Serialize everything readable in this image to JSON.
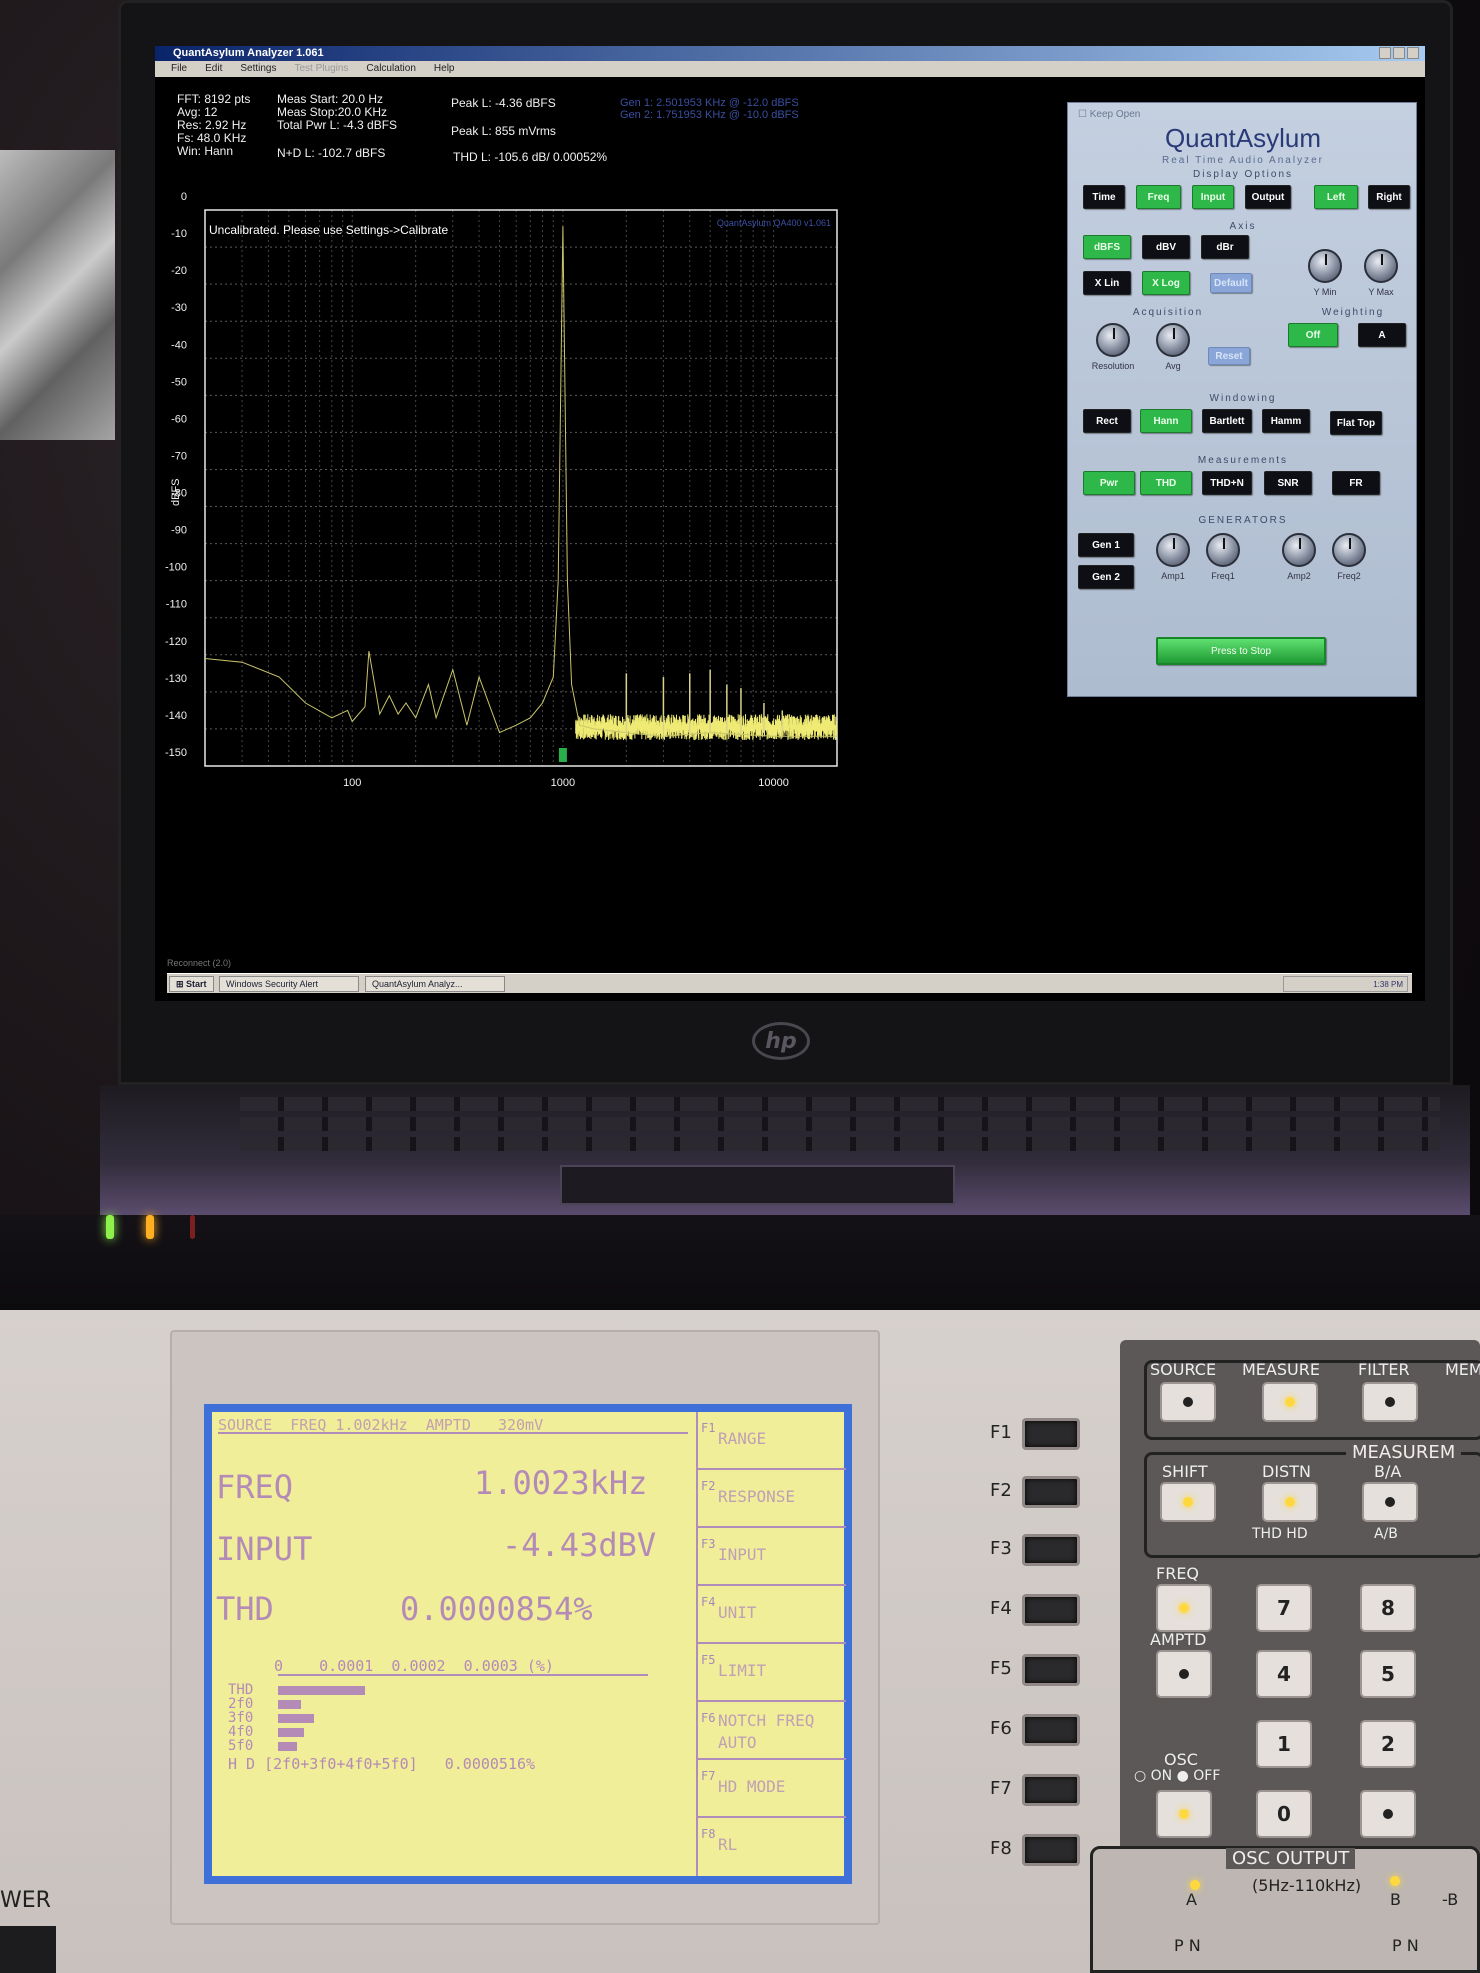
{
  "app": {
    "title": "QuantAsylum Analyzer 1.061",
    "menu": [
      "File",
      "Edit",
      "Settings",
      "Test Plugins",
      "Calculation",
      "Help"
    ]
  },
  "stats": {
    "fft": "FFT: 8192 pts",
    "avg": "Avg: 12",
    "res": "Res: 2.92 Hz",
    "fs": "Fs: 48.0 KHz",
    "win": "Win: Hann",
    "meas_start": "Meas Start: 20.0 Hz",
    "meas_stop": "Meas Stop:20.0 KHz",
    "total_pwr": "Total Pwr L: -4.3 dBFS",
    "nd": "N+D L: -102.7 dBFS",
    "peak_dbfs": "Peak L: -4.36 dBFS",
    "peak_mv": "Peak L: 855 mVrms",
    "thd": "THD L: -105.6 dB/ 0.00052%",
    "gen1": "Gen 1: 2.501953 KHz @ -12.0  dBFS",
    "gen2": "Gen 2: 1.751953 KHz @ -10.0  dBFS"
  },
  "chart_data": {
    "type": "line",
    "ylabel": "dBFS",
    "xscale": "log",
    "xlim": [
      20,
      20000
    ],
    "ylim": [
      -150,
      0
    ],
    "yticks": [
      "0",
      "-10",
      "-20",
      "-30",
      "-40",
      "-50",
      "-60",
      "-70",
      "-80",
      "-90",
      "-100",
      "-110",
      "-120",
      "-130",
      "-140",
      "-150"
    ],
    "xticks": [
      "100",
      "1000",
      "10000"
    ],
    "note": "Uncalibrated. Please use Settings->Calibrate",
    "watermark": "QuantAsylum QA400 v1.061",
    "grid": true,
    "x": [
      20,
      30,
      45,
      60,
      80,
      95,
      100,
      115,
      120,
      135,
      150,
      165,
      180,
      200,
      230,
      250,
      300,
      350,
      400,
      500,
      600,
      700,
      800,
      900,
      950,
      1000,
      1050,
      1100,
      1200,
      1400,
      2000,
      3000,
      5000,
      10000,
      20000
    ],
    "y": [
      -121,
      -122,
      -126,
      -133,
      -137,
      -135,
      -138,
      -134,
      -119,
      -136,
      -131,
      -136,
      -133,
      -137,
      -128,
      -137,
      -124,
      -139,
      -126,
      -141,
      -139,
      -137,
      -133,
      -126,
      -100,
      -4.4,
      -100,
      -128,
      -139,
      -140,
      -141,
      -142,
      -141,
      -142,
      -142
    ],
    "harmonics_x": [
      2000,
      3000,
      4000,
      5000,
      6000,
      7000,
      9000,
      11000
    ],
    "harmonics_y": [
      -125,
      -126,
      -125,
      -124,
      -128,
      -129,
      -133,
      -135
    ]
  },
  "panel": {
    "keep_open": "Keep Open",
    "brand": "QuantAsylum",
    "subtitle": "Real Time Audio Analyzer",
    "sections": {
      "display": "Display Options",
      "axis": "Axis",
      "acquisition": "Acquisition",
      "weighting": "Weighting",
      "windowing": "Windowing",
      "measurements": "Measurements",
      "generators": "GENERATORS"
    },
    "display_buttons": [
      "Time",
      "Freq",
      "Input",
      "Output",
      "Left",
      "Right"
    ],
    "axis_buttons": [
      "dBFS",
      "dBV",
      "dBr"
    ],
    "xaxis_buttons": [
      "X Lin",
      "X Log",
      "Default"
    ],
    "axis_knobs": [
      "Y Min",
      "Y Max"
    ],
    "acq_knobs": [
      "Resolution",
      "Avg"
    ],
    "reset": "Reset",
    "weighting_buttons": [
      "Off",
      "A"
    ],
    "window_buttons": [
      "Rect",
      "Hann",
      "Bartlett",
      "Hamm",
      "Flat Top"
    ],
    "meas_buttons": [
      "Pwr",
      "THD",
      "THD+N",
      "SNR",
      "FR"
    ],
    "gen_buttons": [
      "Gen 1",
      "Gen 2"
    ],
    "gen_knobs": [
      "Amp1",
      "Freq1",
      "Amp2",
      "Freq2"
    ],
    "stop": "Press to Stop"
  },
  "statusbar": "Reconnect (2.0)",
  "taskbar": {
    "start": "Start",
    "item1": "Windows Security Alert",
    "item2": "QuantAsylum Analyz...",
    "clock": "1:38 PM"
  },
  "instrument": {
    "header": "SOURCE  FREQ 1.002kHz  AMPTD   320mV",
    "freq_label": "FREQ",
    "freq_value": "1.0023kHz",
    "input_label": "INPUT",
    "input_value": "-4.43dBV",
    "thd_label": "THD",
    "thd_value": "0.0000854%",
    "scale": "0    0.0001  0.0002  0.0003 (%)",
    "bar_labels": [
      "THD",
      "2f0",
      "3f0",
      "4f0",
      "5f0"
    ],
    "bar_values": [
      8.5e-05,
      2.2e-05,
      3.5e-05,
      2.5e-05,
      1.8e-05
    ],
    "hd_line": "H D [2f0+3f0+4f0+5f0]   0.0000516%",
    "fkeys": [
      {
        "n": "F1",
        "label": "RANGE"
      },
      {
        "n": "F2",
        "label": "RESPONSE"
      },
      {
        "n": "F3",
        "label": "INPUT"
      },
      {
        "n": "F4",
        "label": "UNIT"
      },
      {
        "n": "F5",
        "label": "LIMIT"
      },
      {
        "n": "F6",
        "label": "NOTCH FREQ\nAUTO"
      },
      {
        "n": "F7",
        "label": "HD MODE"
      },
      {
        "n": "F8",
        "label": "RL"
      }
    ],
    "hw_f_labels": [
      "F1",
      "F2",
      "F3",
      "F4",
      "F5",
      "F6",
      "F7",
      "F8"
    ],
    "top_keys": [
      "SOURCE",
      "MEASURE",
      "FILTER",
      "MEM"
    ],
    "measure_group": "MEASUREM",
    "shift": "SHIFT",
    "distn": "DISTN",
    "ba": "B/A",
    "thd_hd": "THD HD",
    "ab": "A/B",
    "freq_key": "FREQ",
    "amptd_key": "AMPTD",
    "osc": "OSC",
    "osc_onoff": "○ ON ● OFF",
    "digits": [
      "7",
      "8",
      "4",
      "5",
      "1",
      "2",
      "0"
    ],
    "osc_output": "OSC OUTPUT",
    "osc_range": "(5Hz-110kHz)",
    "ch_a": "A",
    "ch_b": "B",
    "ch_b_neg": "-B",
    "pn": "P  N",
    "power": "WER"
  }
}
